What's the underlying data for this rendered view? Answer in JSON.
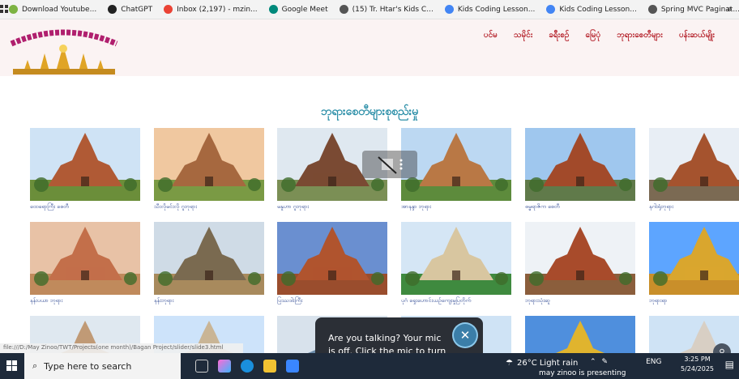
{
  "bookmarks": [
    {
      "label": "Download Youtube...",
      "icon": "youtube-download-icon",
      "color": "#7cb342"
    },
    {
      "label": "ChatGPT",
      "icon": "chatgpt-icon",
      "color": "#222222"
    },
    {
      "label": "Inbox (2,197) - mzin...",
      "icon": "gmail-icon",
      "color": "#ea4335"
    },
    {
      "label": "Google Meet",
      "icon": "google-meet-icon",
      "color": "#00897b"
    },
    {
      "label": "(15) Tr. Htar's Kids C...",
      "icon": "globe-icon",
      "color": "#555555"
    },
    {
      "label": "Kids Coding Lesson...",
      "icon": "drive-icon",
      "color": "#4285f4"
    },
    {
      "label": "Kids Coding Lesson...",
      "icon": "drive-icon",
      "color": "#4285f4"
    },
    {
      "label": "Spring MVC Paginat...",
      "icon": "globe-icon",
      "color": "#555555"
    }
  ],
  "site": {
    "nav": [
      "ပင်မ",
      "သမိုင်း",
      "ခရီးစဉ်",
      "မြေပုံ",
      "ဘုရားစေတီများ",
      "ပန်းဆယ်မျိုး"
    ],
    "title": "ဘုရားစေတီများစုစည်းမှု",
    "status_url": "file:///D:/May Zinoo/TWT/Projects(one month)/Bagan Project/slider/slide3.html"
  },
  "pagodas": [
    {
      "caption": "ထေရောကြီး စေတီ"
    },
    {
      "caption": "သီးလိုမင်းလို ဂူဘုရား"
    },
    {
      "caption": "မနူဟာ ဂူဘုရား"
    },
    {
      "caption": "အာနန္ဒာ ဘုရား"
    },
    {
      "caption": "ဓမ္မရာဇိက စေတီ"
    },
    {
      "caption": "နဂါးရုံဘုရား"
    },
    {
      "caption": "နန်းပယာ ဘုရား"
    },
    {
      "caption": "နန်းဘုရား"
    },
    {
      "caption": "ပြဿဒါးကြီး"
    },
    {
      "caption": "ပုဂံ ရှေးဟောင်းယဉ်ကျေးမှုပြတိုက်"
    },
    {
      "caption": "ဘုရားသုံးဆူ"
    },
    {
      "caption": "ဘုရားရာ"
    },
    {
      "caption": ""
    },
    {
      "caption": ""
    },
    {
      "caption": ""
    },
    {
      "caption": ""
    },
    {
      "caption": ""
    },
    {
      "caption": ""
    }
  ],
  "toast": {
    "message": "Are you talking? Your mic is off. Click the mic to turn it on."
  },
  "taskbar": {
    "search_placeholder": "Type here to search",
    "weather": "26°C  Light rain",
    "language": "ENG",
    "time": "3:25 PM",
    "date": "5/24/2025",
    "presenting": "may zinoo is presenting"
  }
}
